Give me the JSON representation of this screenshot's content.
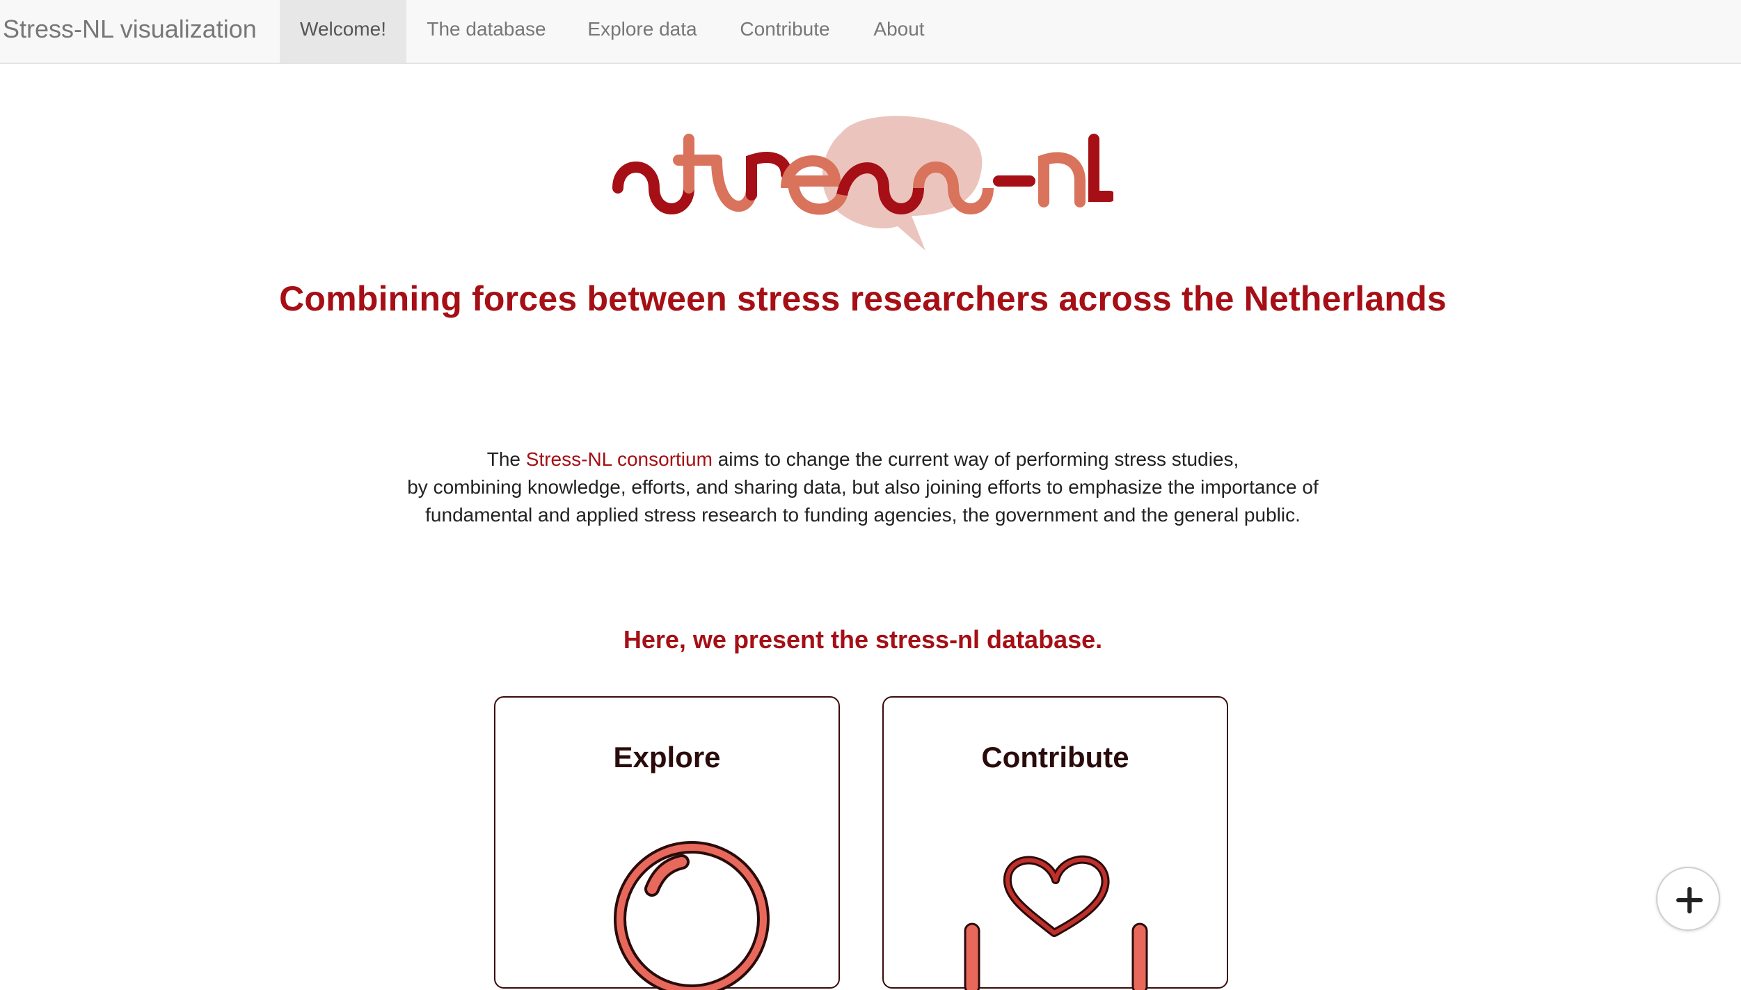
{
  "navbar": {
    "brand": "Stress-NL visualization",
    "items": [
      {
        "label": "Welcome!",
        "active": true
      },
      {
        "label": "The database",
        "active": false
      },
      {
        "label": "Explore data",
        "active": false
      },
      {
        "label": "Contribute",
        "active": false
      },
      {
        "label": "About",
        "active": false
      }
    ]
  },
  "logo": {
    "wordmark": "stress-nl",
    "colors": {
      "dark_red": "#a50f15",
      "salmon": "#d9735c",
      "brain_pink": "#ebc5bd"
    }
  },
  "headline": "Combining forces between stress researchers across the Netherlands",
  "intro": {
    "prefix": "The ",
    "link": "Stress-NL consortium",
    "line1_rest": " aims to change the current way of performing stress studies,",
    "line2": "by combining knowledge, efforts, and sharing data, but also joining efforts to emphasize the importance of",
    "line3": "fundamental and applied stress research to funding agencies, the government and the general public."
  },
  "subhead": "Here, we present the stress-nl database.",
  "cards": [
    {
      "title": "Explore",
      "icon": "magnifier-icon"
    },
    {
      "title": "Contribute",
      "icon": "heart-hands-icon"
    }
  ],
  "fab": {
    "icon": "plus-icon"
  },
  "colors": {
    "accent": "#a50f15",
    "navbar_bg": "#f8f8f8",
    "nav_active_bg": "#e7e7e7",
    "icon_fill": "#e8695c"
  }
}
